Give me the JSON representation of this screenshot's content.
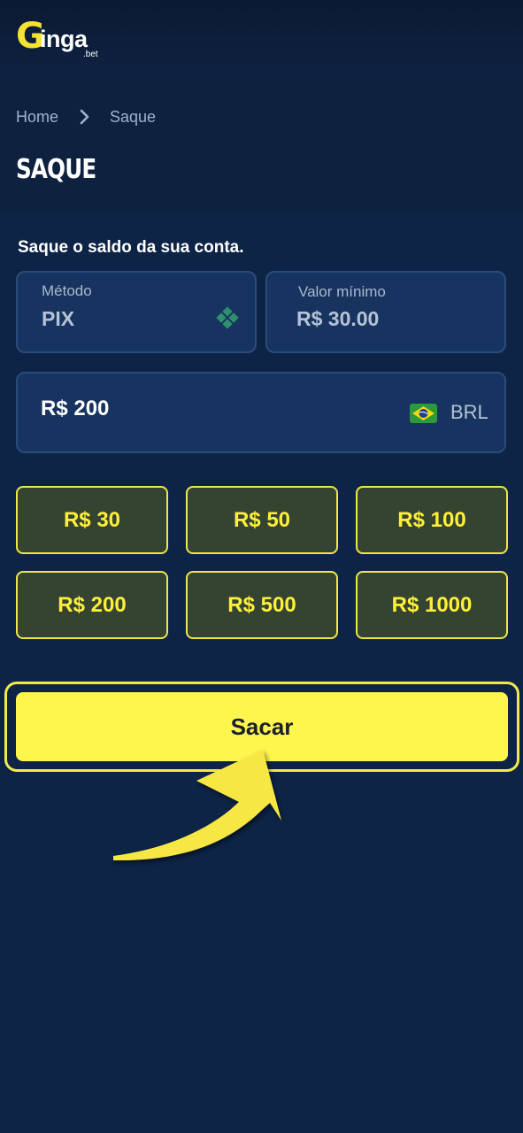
{
  "brand": {
    "logo_letter": "G",
    "logo_text": "inga",
    "logo_sub": ".bet"
  },
  "breadcrumb": {
    "home": "Home",
    "current": "Saque"
  },
  "page": {
    "title": "SAQUE",
    "subtitle": "Saque o saldo da sua conta."
  },
  "method": {
    "label": "Método",
    "value": "PIX",
    "icon": "pix-icon"
  },
  "min_value": {
    "label": "Valor mínimo",
    "value": "R$ 30.00"
  },
  "amount": {
    "value": "R$ 200",
    "currency": "BRL",
    "flag_icon": "brazil-flag-icon"
  },
  "quick_amounts": [
    "R$ 30",
    "R$ 50",
    "R$ 100",
    "R$ 200",
    "R$ 500",
    "R$ 1000"
  ],
  "submit": {
    "label": "Sacar"
  },
  "colors": {
    "background": "#0d2447",
    "accent": "#fff64d",
    "quick_bg": "#344430",
    "quick_border": "#efe64a"
  }
}
